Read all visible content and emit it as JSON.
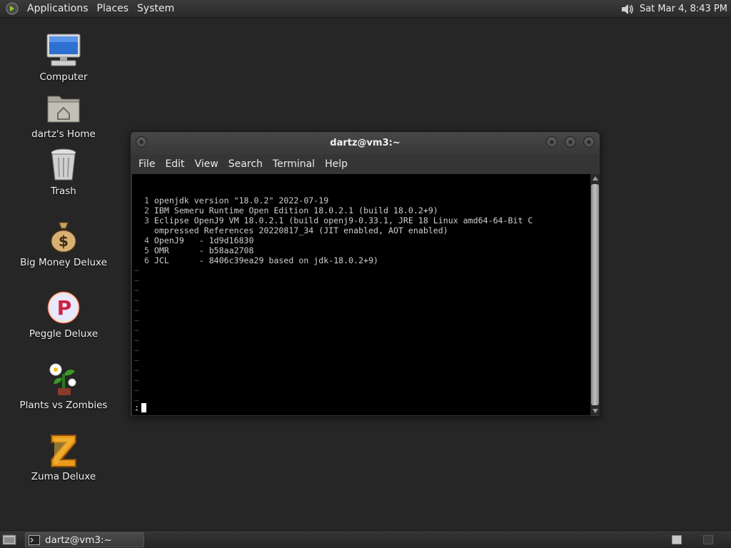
{
  "top_panel": {
    "menus": [
      "Applications",
      "Places",
      "System"
    ],
    "clock": "Sat Mar  4,  8:43 PM",
    "icons": [
      "gnome-foot-icon",
      "volume-icon"
    ]
  },
  "desktop": {
    "icons": [
      {
        "label": "Computer",
        "icon": "computer-icon"
      },
      {
        "label": "dartz's Home",
        "icon": "home-folder-icon"
      },
      {
        "label": "Trash",
        "icon": "trash-icon"
      },
      {
        "label": "Big Money Deluxe",
        "icon": "money-bag-icon"
      },
      {
        "label": "Peggle Deluxe",
        "icon": "peggle-icon"
      },
      {
        "label": "Plants vs Zombies",
        "icon": "plant-icon"
      },
      {
        "label": "Zuma Deluxe",
        "icon": "zuma-icon"
      }
    ]
  },
  "terminal": {
    "title": "dartz@vm3:~",
    "menus": [
      "File",
      "Edit",
      "View",
      "Search",
      "Terminal",
      "Help"
    ],
    "lines": [
      {
        "n": "1",
        "text": "openjdk version \"18.0.2\" 2022-07-19"
      },
      {
        "n": "2",
        "text": "IBM Semeru Runtime Open Edition 18.0.2.1 (build 18.0.2+9)"
      },
      {
        "n": "3",
        "text": "Eclipse OpenJ9 VM 18.0.2.1 (build openj9-0.33.1, JRE 18 Linux amd64-64-Bit C"
      },
      {
        "n": "",
        "text": "ompressed References 20220817_34 (JIT enabled, AOT enabled)"
      },
      {
        "n": "4",
        "text": "OpenJ9   - 1d9d16830"
      },
      {
        "n": "5",
        "text": "OMR      - b58aa2708"
      },
      {
        "n": "6",
        "text": "JCL      - 8406c39ea29 based on jdk-18.0.2+9)"
      }
    ],
    "tilde_count": 16,
    "prompt": ":"
  },
  "bottom_panel": {
    "task": "dartz@vm3:~"
  },
  "colors": {
    "desktop": "#262626",
    "terminal_bg": "#000000",
    "tilde": "#4a4a7a"
  }
}
